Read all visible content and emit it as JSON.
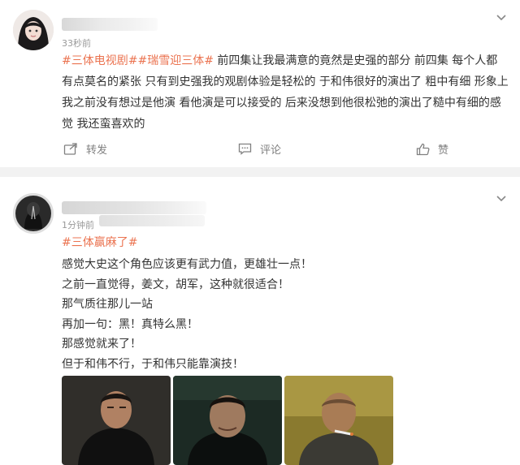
{
  "post1": {
    "time": "33秒前",
    "tags": [
      "#三体电视剧#",
      "#瑞雪迎三体#"
    ],
    "text": " 前四集让我最满意的竟然是史强的部分 前四集 每个人都有点莫名的紧张 只有到史强我的观剧体验是轻松的 于和伟很好的演出了 粗中有细 形象上我之前没有想过是他演 看他演是可以接受的 后来没想到他很松弛的演出了糙中有细的感觉 我还蛮喜欢的",
    "actions": {
      "repost": "转发",
      "comment": "评论",
      "like": "赞"
    }
  },
  "post2": {
    "time": "1分钟前",
    "tag": "#三体赢麻了#",
    "lines": [
      "感觉大史这个角色应该更有武力值，更雄壮一点！",
      "之前一直觉得，姜文，胡军，这种就很适合！",
      "那气质往那儿一站",
      "再加一句：黑！真特么黑！",
      "那感觉就来了！",
      "但于和伟不行，于和伟只能靠演技！"
    ],
    "photos": [
      "photo-1",
      "photo-2",
      "photo-3"
    ]
  },
  "colors": {
    "tag": "#eb7350",
    "text": "#333333",
    "meta": "#999999",
    "separator": "#f2f2f2"
  }
}
